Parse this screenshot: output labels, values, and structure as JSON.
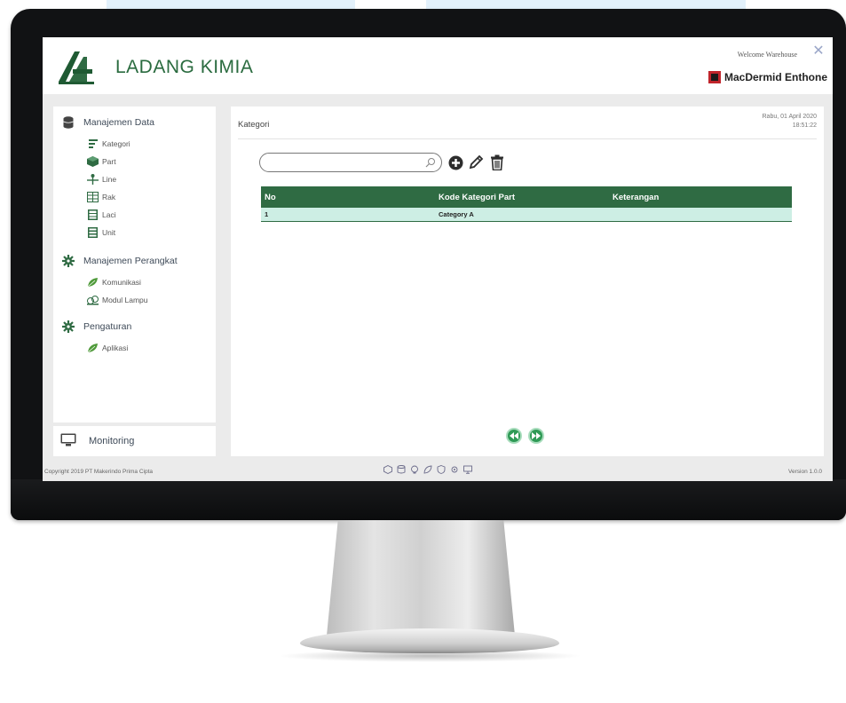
{
  "app": {
    "title": "LADANG KIMIA"
  },
  "header": {
    "welcome_text": "Welcome Warehouse",
    "brand": "MacDermid Enthone"
  },
  "sidebar": {
    "sections": [
      {
        "label": "Manajemen Data",
        "icon": "database-icon",
        "items": [
          {
            "label": "Kategori",
            "icon": "category-icon"
          },
          {
            "label": "Part",
            "icon": "part-icon"
          },
          {
            "label": "Line",
            "icon": "line-icon"
          },
          {
            "label": "Rak",
            "icon": "rack-icon"
          },
          {
            "label": "Laci",
            "icon": "drawer-icon"
          },
          {
            "label": "Unit",
            "icon": "unit-icon"
          }
        ]
      },
      {
        "label": "Manajemen Perangkat",
        "icon": "gear-icon",
        "items": [
          {
            "label": "Komunikasi",
            "icon": "leaf-icon"
          },
          {
            "label": "Modul Lampu",
            "icon": "lamp-module-icon"
          }
        ]
      },
      {
        "label": "Pengaturan",
        "icon": "gear-icon",
        "items": [
          {
            "label": "Aplikasi",
            "icon": "leaf-icon"
          }
        ]
      }
    ],
    "monitoring": {
      "label": "Monitoring",
      "icon": "monitor-icon"
    }
  },
  "main": {
    "title": "Kategori",
    "date": "Rabu, 01 April 2020",
    "time": "18:51:22",
    "search": {
      "value": "",
      "placeholder": ""
    },
    "toolbar": [
      "add-icon",
      "edit-icon",
      "delete-icon"
    ],
    "table": {
      "headers": [
        "No",
        "Kode Kategori Part",
        "Keterangan"
      ],
      "rows": [
        [
          "1",
          "Category A",
          ""
        ]
      ]
    },
    "pager": [
      "previous-page-icon",
      "next-page-icon"
    ]
  },
  "footer": {
    "copyright": "Copyright 2019 PT Makerindo Prima Cipta",
    "version": "Version 1.0.0"
  },
  "colors": {
    "primary_green": "#2f6b43",
    "row_highlight": "#cdeee4",
    "pager_green": "#2e9a55"
  }
}
